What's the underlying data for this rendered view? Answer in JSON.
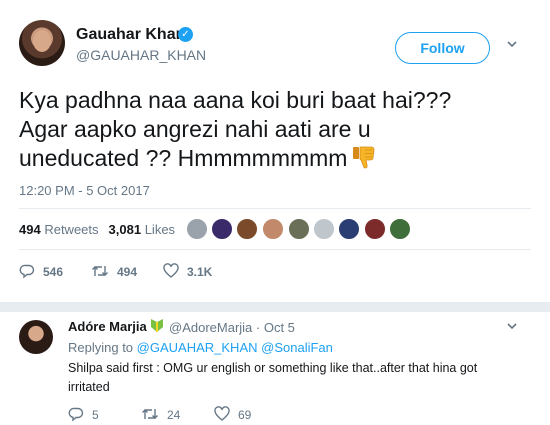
{
  "author": {
    "name": "Gauahar Khan",
    "handle": "@GAUAHAR_KHAN",
    "verified": true
  },
  "follow_label": "Follow",
  "tweet": {
    "lines": [
      "Kya padhna naa aana koi buri baat hai???",
      "Agar aapko angrezi nahi aati are u",
      "uneducated ?? Hmmmmmmmm"
    ],
    "emoji": "thumbs-down",
    "timestamp": "12:20 PM - 5 Oct 2017"
  },
  "stats": {
    "retweets_count": "494",
    "retweets_label": "Retweets",
    "likes_count": "3,081",
    "likes_label": "Likes"
  },
  "actions": {
    "replies": "546",
    "retweets": "494",
    "likes": "3.1K"
  },
  "reply": {
    "name": "Adóre Marjia",
    "handle_date": "@AdoreMarjia · Oct 5",
    "replying_prefix": "Replying to",
    "replying_to_1": "@GAUAHAR_KHAN",
    "replying_to_2": "@SonaliFan",
    "text": "Shilpa said first : OMG ur english or something like that..after that hina got irritated",
    "replies": "5",
    "retweets": "24",
    "likes": "69"
  },
  "colors": {
    "accent": "#1da1f2",
    "secondary_text": "#657786",
    "divider": "#e6ecf0"
  }
}
